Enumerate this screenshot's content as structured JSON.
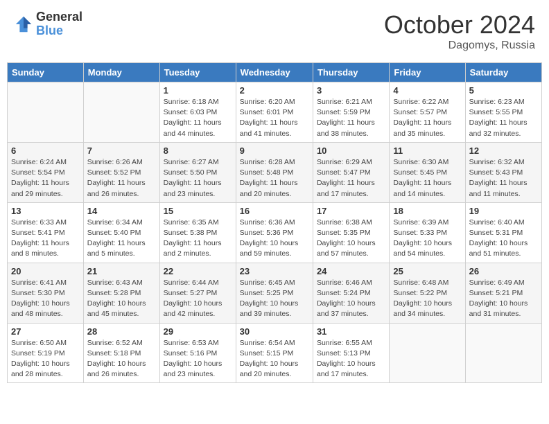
{
  "header": {
    "logo_general": "General",
    "logo_blue": "Blue",
    "title": "October 2024",
    "location": "Dagomys, Russia"
  },
  "days_of_week": [
    "Sunday",
    "Monday",
    "Tuesday",
    "Wednesday",
    "Thursday",
    "Friday",
    "Saturday"
  ],
  "weeks": [
    [
      {
        "day": "",
        "sunrise": "",
        "sunset": "",
        "daylight": ""
      },
      {
        "day": "",
        "sunrise": "",
        "sunset": "",
        "daylight": ""
      },
      {
        "day": "1",
        "sunrise": "Sunrise: 6:18 AM",
        "sunset": "Sunset: 6:03 PM",
        "daylight": "Daylight: 11 hours and 44 minutes."
      },
      {
        "day": "2",
        "sunrise": "Sunrise: 6:20 AM",
        "sunset": "Sunset: 6:01 PM",
        "daylight": "Daylight: 11 hours and 41 minutes."
      },
      {
        "day": "3",
        "sunrise": "Sunrise: 6:21 AM",
        "sunset": "Sunset: 5:59 PM",
        "daylight": "Daylight: 11 hours and 38 minutes."
      },
      {
        "day": "4",
        "sunrise": "Sunrise: 6:22 AM",
        "sunset": "Sunset: 5:57 PM",
        "daylight": "Daylight: 11 hours and 35 minutes."
      },
      {
        "day": "5",
        "sunrise": "Sunrise: 6:23 AM",
        "sunset": "Sunset: 5:55 PM",
        "daylight": "Daylight: 11 hours and 32 minutes."
      }
    ],
    [
      {
        "day": "6",
        "sunrise": "Sunrise: 6:24 AM",
        "sunset": "Sunset: 5:54 PM",
        "daylight": "Daylight: 11 hours and 29 minutes."
      },
      {
        "day": "7",
        "sunrise": "Sunrise: 6:26 AM",
        "sunset": "Sunset: 5:52 PM",
        "daylight": "Daylight: 11 hours and 26 minutes."
      },
      {
        "day": "8",
        "sunrise": "Sunrise: 6:27 AM",
        "sunset": "Sunset: 5:50 PM",
        "daylight": "Daylight: 11 hours and 23 minutes."
      },
      {
        "day": "9",
        "sunrise": "Sunrise: 6:28 AM",
        "sunset": "Sunset: 5:48 PM",
        "daylight": "Daylight: 11 hours and 20 minutes."
      },
      {
        "day": "10",
        "sunrise": "Sunrise: 6:29 AM",
        "sunset": "Sunset: 5:47 PM",
        "daylight": "Daylight: 11 hours and 17 minutes."
      },
      {
        "day": "11",
        "sunrise": "Sunrise: 6:30 AM",
        "sunset": "Sunset: 5:45 PM",
        "daylight": "Daylight: 11 hours and 14 minutes."
      },
      {
        "day": "12",
        "sunrise": "Sunrise: 6:32 AM",
        "sunset": "Sunset: 5:43 PM",
        "daylight": "Daylight: 11 hours and 11 minutes."
      }
    ],
    [
      {
        "day": "13",
        "sunrise": "Sunrise: 6:33 AM",
        "sunset": "Sunset: 5:41 PM",
        "daylight": "Daylight: 11 hours and 8 minutes."
      },
      {
        "day": "14",
        "sunrise": "Sunrise: 6:34 AM",
        "sunset": "Sunset: 5:40 PM",
        "daylight": "Daylight: 11 hours and 5 minutes."
      },
      {
        "day": "15",
        "sunrise": "Sunrise: 6:35 AM",
        "sunset": "Sunset: 5:38 PM",
        "daylight": "Daylight: 11 hours and 2 minutes."
      },
      {
        "day": "16",
        "sunrise": "Sunrise: 6:36 AM",
        "sunset": "Sunset: 5:36 PM",
        "daylight": "Daylight: 10 hours and 59 minutes."
      },
      {
        "day": "17",
        "sunrise": "Sunrise: 6:38 AM",
        "sunset": "Sunset: 5:35 PM",
        "daylight": "Daylight: 10 hours and 57 minutes."
      },
      {
        "day": "18",
        "sunrise": "Sunrise: 6:39 AM",
        "sunset": "Sunset: 5:33 PM",
        "daylight": "Daylight: 10 hours and 54 minutes."
      },
      {
        "day": "19",
        "sunrise": "Sunrise: 6:40 AM",
        "sunset": "Sunset: 5:31 PM",
        "daylight": "Daylight: 10 hours and 51 minutes."
      }
    ],
    [
      {
        "day": "20",
        "sunrise": "Sunrise: 6:41 AM",
        "sunset": "Sunset: 5:30 PM",
        "daylight": "Daylight: 10 hours and 48 minutes."
      },
      {
        "day": "21",
        "sunrise": "Sunrise: 6:43 AM",
        "sunset": "Sunset: 5:28 PM",
        "daylight": "Daylight: 10 hours and 45 minutes."
      },
      {
        "day": "22",
        "sunrise": "Sunrise: 6:44 AM",
        "sunset": "Sunset: 5:27 PM",
        "daylight": "Daylight: 10 hours and 42 minutes."
      },
      {
        "day": "23",
        "sunrise": "Sunrise: 6:45 AM",
        "sunset": "Sunset: 5:25 PM",
        "daylight": "Daylight: 10 hours and 39 minutes."
      },
      {
        "day": "24",
        "sunrise": "Sunrise: 6:46 AM",
        "sunset": "Sunset: 5:24 PM",
        "daylight": "Daylight: 10 hours and 37 minutes."
      },
      {
        "day": "25",
        "sunrise": "Sunrise: 6:48 AM",
        "sunset": "Sunset: 5:22 PM",
        "daylight": "Daylight: 10 hours and 34 minutes."
      },
      {
        "day": "26",
        "sunrise": "Sunrise: 6:49 AM",
        "sunset": "Sunset: 5:21 PM",
        "daylight": "Daylight: 10 hours and 31 minutes."
      }
    ],
    [
      {
        "day": "27",
        "sunrise": "Sunrise: 6:50 AM",
        "sunset": "Sunset: 5:19 PM",
        "daylight": "Daylight: 10 hours and 28 minutes."
      },
      {
        "day": "28",
        "sunrise": "Sunrise: 6:52 AM",
        "sunset": "Sunset: 5:18 PM",
        "daylight": "Daylight: 10 hours and 26 minutes."
      },
      {
        "day": "29",
        "sunrise": "Sunrise: 6:53 AM",
        "sunset": "Sunset: 5:16 PM",
        "daylight": "Daylight: 10 hours and 23 minutes."
      },
      {
        "day": "30",
        "sunrise": "Sunrise: 6:54 AM",
        "sunset": "Sunset: 5:15 PM",
        "daylight": "Daylight: 10 hours and 20 minutes."
      },
      {
        "day": "31",
        "sunrise": "Sunrise: 6:55 AM",
        "sunset": "Sunset: 5:13 PM",
        "daylight": "Daylight: 10 hours and 17 minutes."
      },
      {
        "day": "",
        "sunrise": "",
        "sunset": "",
        "daylight": ""
      },
      {
        "day": "",
        "sunrise": "",
        "sunset": "",
        "daylight": ""
      }
    ]
  ]
}
